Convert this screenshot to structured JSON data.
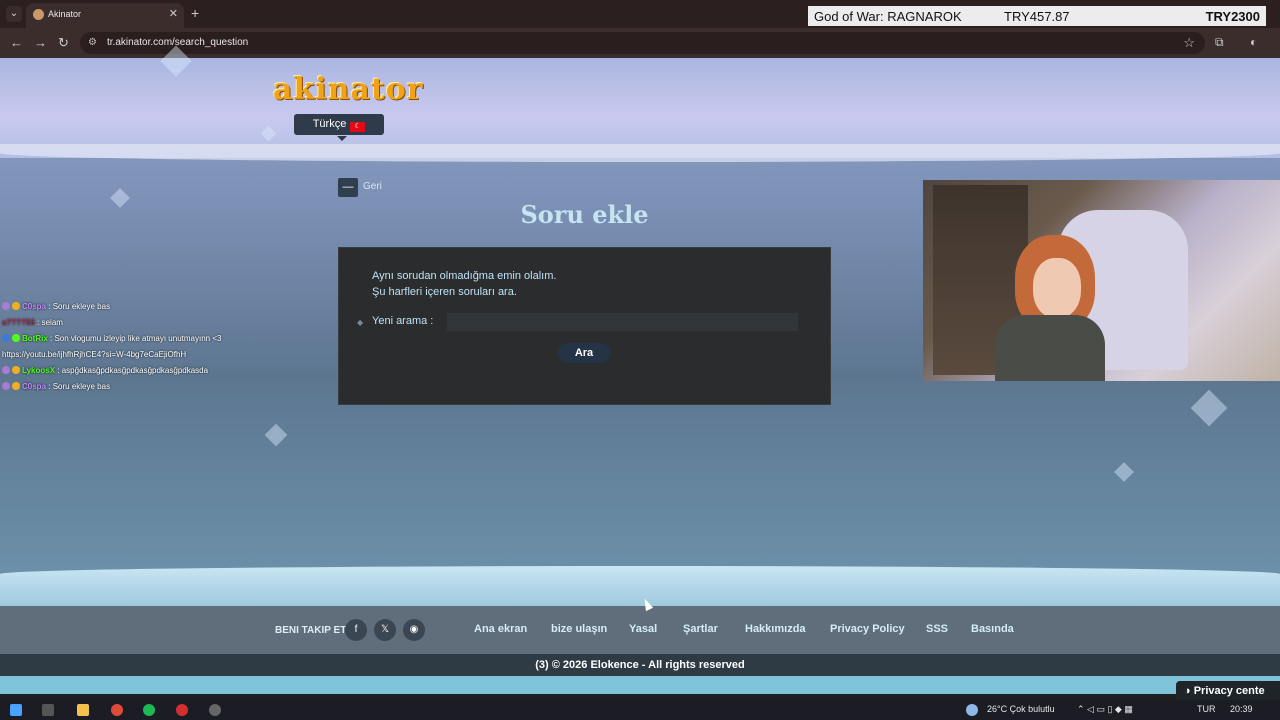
{
  "browser": {
    "tab_title": "Akinator",
    "url": "tr.akinator.com/search_question",
    "overlay_game": "God of War: RAGNAROK",
    "overlay_price": "TRY457.87",
    "overlay_price2": "TRY2300"
  },
  "header": {
    "logo": "akinator",
    "language_label": "Türkçe"
  },
  "page": {
    "back_label": "Geri",
    "title": "Soru ekle"
  },
  "card": {
    "line1": "Aynı sorudan olmadığma emin olalım.",
    "line2": "Şu harfleri içeren soruları ara.",
    "search_label": "Yeni arama :",
    "search_value": "",
    "search_button": "Ara"
  },
  "chat": [
    {
      "user": "C0spa",
      "text": ": Soru ekleye bas",
      "color": "#c58bff"
    },
    {
      "user": "a????56",
      "text": ": selam",
      "color": "#b0304a"
    },
    {
      "user": "BotRix",
      "text": ": Son vlogumu izleyip like atmayı unutmayınn <3",
      "color": "#53fc18"
    },
    {
      "user": "",
      "text": "https://youtu.be/ijhfhRjhCE4?si=W-4bg7eCaEjiOfhH",
      "color": "#ffffff"
    },
    {
      "user": "LykoosX",
      "text": ": aspğdkasğpdkasğpdkasğpdkasğpdkasda",
      "color": "#53fc18"
    },
    {
      "user": "C0spa",
      "text": ": Soru ekleye bas",
      "color": "#c58bff"
    }
  ],
  "footer": {
    "follow_label": "BENI TAKIP ET",
    "links": [
      "Ana ekran",
      "bize ulaşın",
      "Yasal",
      "Şartlar",
      "Hakkımızda",
      "Privacy Policy",
      "SSS",
      "Basında"
    ],
    "copyright": "(3)  © 2026 Elokence - All rights reserved",
    "privacy": "Privacy cente"
  },
  "taskbar": {
    "weather": "26°C  Çok bulutlu",
    "lang": "TUR",
    "time": "20:39"
  }
}
